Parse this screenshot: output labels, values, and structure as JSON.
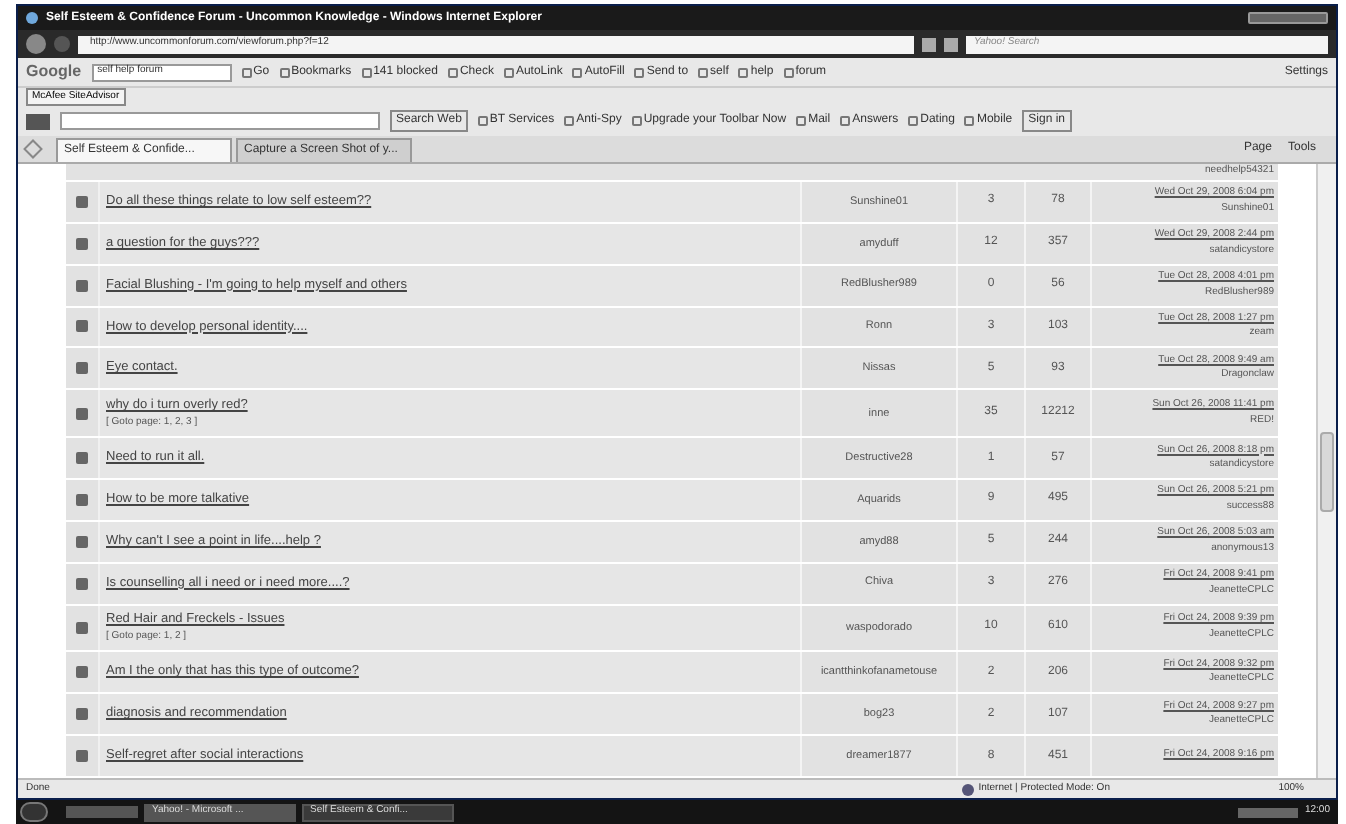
{
  "window": {
    "title": "Self Esteem & Confidence Forum - Uncommon Knowledge - Windows Internet Explorer"
  },
  "address_bar": {
    "url": "http://www.uncommonforum.com/viewforum.php?f=12"
  },
  "search_box": {
    "placeholder": "Yahoo! Search"
  },
  "google_toolbar": {
    "logo": "Google",
    "query": "self help forum",
    "items": [
      "Go",
      "Bookmarks",
      "141 blocked",
      "Check",
      "AutoLink",
      "AutoFill",
      "Send to",
      "self",
      "help",
      "forum"
    ],
    "settings": "Settings"
  },
  "mcafee_toolbar": {
    "label": "McAfee SiteAdvisor"
  },
  "yahoo_toolbar": {
    "search_button": "Search Web",
    "items": [
      "BT Services",
      "Anti-Spy",
      "Upgrade your Toolbar Now",
      "Mail",
      "Answers",
      "Dating",
      "Mobile"
    ],
    "sign_in": "Sign in"
  },
  "tabs": [
    {
      "label": "Self Esteem & Confide...",
      "selected": true
    },
    {
      "label": "Capture a Screen Shot of y...",
      "selected": false
    }
  ],
  "command_bar": [
    "Page",
    "Tools"
  ],
  "forum": {
    "cut_row": {
      "last_user": "needhelp54321"
    },
    "topics": [
      {
        "title": "Do all these things relate to low self esteem??",
        "author": "Sunshine01",
        "replies": "3",
        "views": "78",
        "last_date": "Wed Oct 29, 2008 6:04 pm",
        "last_user": "Sunshine01"
      },
      {
        "title": "a question for the guys???",
        "author": "amyduff",
        "replies": "12",
        "views": "357",
        "last_date": "Wed Oct 29, 2008 2:44 pm",
        "last_user": "satandicystore"
      },
      {
        "title": "Facial Blushing - I'm going to help myself and others",
        "author": "RedBlusher989",
        "replies": "0",
        "views": "56",
        "last_date": "Tue Oct 28, 2008 4:01 pm",
        "last_user": "RedBlusher989"
      },
      {
        "title": "How to develop personal identity....",
        "author": "Ronn",
        "replies": "3",
        "views": "103",
        "last_date": "Tue Oct 28, 2008 1:27 pm",
        "last_user": "zeam"
      },
      {
        "title": "Eye contact.",
        "author": "Nissas",
        "replies": "5",
        "views": "93",
        "last_date": "Tue Oct 28, 2008 9:49 am",
        "last_user": "Dragonclaw"
      },
      {
        "title": "why do i turn overly red?",
        "goto": "[ Goto page: 1, 2, 3 ]",
        "author": "inne",
        "replies": "35",
        "views": "12212",
        "last_date": "Sun Oct 26, 2008 11:41 pm",
        "last_user": "RED!"
      },
      {
        "title": "Need to run it all.",
        "author": "Destructive28",
        "replies": "1",
        "views": "57",
        "last_date": "Sun Oct 26, 2008 8:18 pm",
        "last_user": "satandicystore"
      },
      {
        "title": "How to be more talkative",
        "author": "Aquarids",
        "replies": "9",
        "views": "495",
        "last_date": "Sun Oct 26, 2008 5:21 pm",
        "last_user": "success88"
      },
      {
        "title": "Why can't I see a point in life....help ?",
        "author": "amyd88",
        "replies": "5",
        "views": "244",
        "last_date": "Sun Oct 26, 2008 5:03 am",
        "last_user": "anonymous13"
      },
      {
        "title": "Is counselling all i need or i need more....?",
        "author": "Chiva",
        "replies": "3",
        "views": "276",
        "last_date": "Fri Oct 24, 2008 9:41 pm",
        "last_user": "JeanetteCPLC"
      },
      {
        "title": "Red Hair and Freckels - Issues",
        "goto": "[ Goto page: 1, 2 ]",
        "author": "waspodorado",
        "replies": "10",
        "views": "610",
        "last_date": "Fri Oct 24, 2008 9:39 pm",
        "last_user": "JeanetteCPLC"
      },
      {
        "title": "Am I the only that has this type of outcome?",
        "author": "icantthinkofanametouse",
        "replies": "2",
        "views": "206",
        "last_date": "Fri Oct 24, 2008 9:32 pm",
        "last_user": "JeanetteCPLC"
      },
      {
        "title": "diagnosis and recommendation",
        "author": "bog23",
        "replies": "2",
        "views": "107",
        "last_date": "Fri Oct 24, 2008 9:27 pm",
        "last_user": "JeanetteCPLC"
      },
      {
        "title": "Self-regret after social interactions",
        "author": "dreamer1877",
        "replies": "8",
        "views": "451",
        "last_date": "Fri Oct 24, 2008 9:16 pm"
      }
    ]
  },
  "status_bar": {
    "text": "Done",
    "zone": "Internet | Protected Mode: On",
    "zoom": "100%"
  },
  "taskbar": {
    "buttons": [
      {
        "label": "Yahoo! - Microsoft ...",
        "selected": false
      },
      {
        "label": "Self Esteem & Confi...",
        "selected": true
      }
    ],
    "clock": "12:00"
  }
}
